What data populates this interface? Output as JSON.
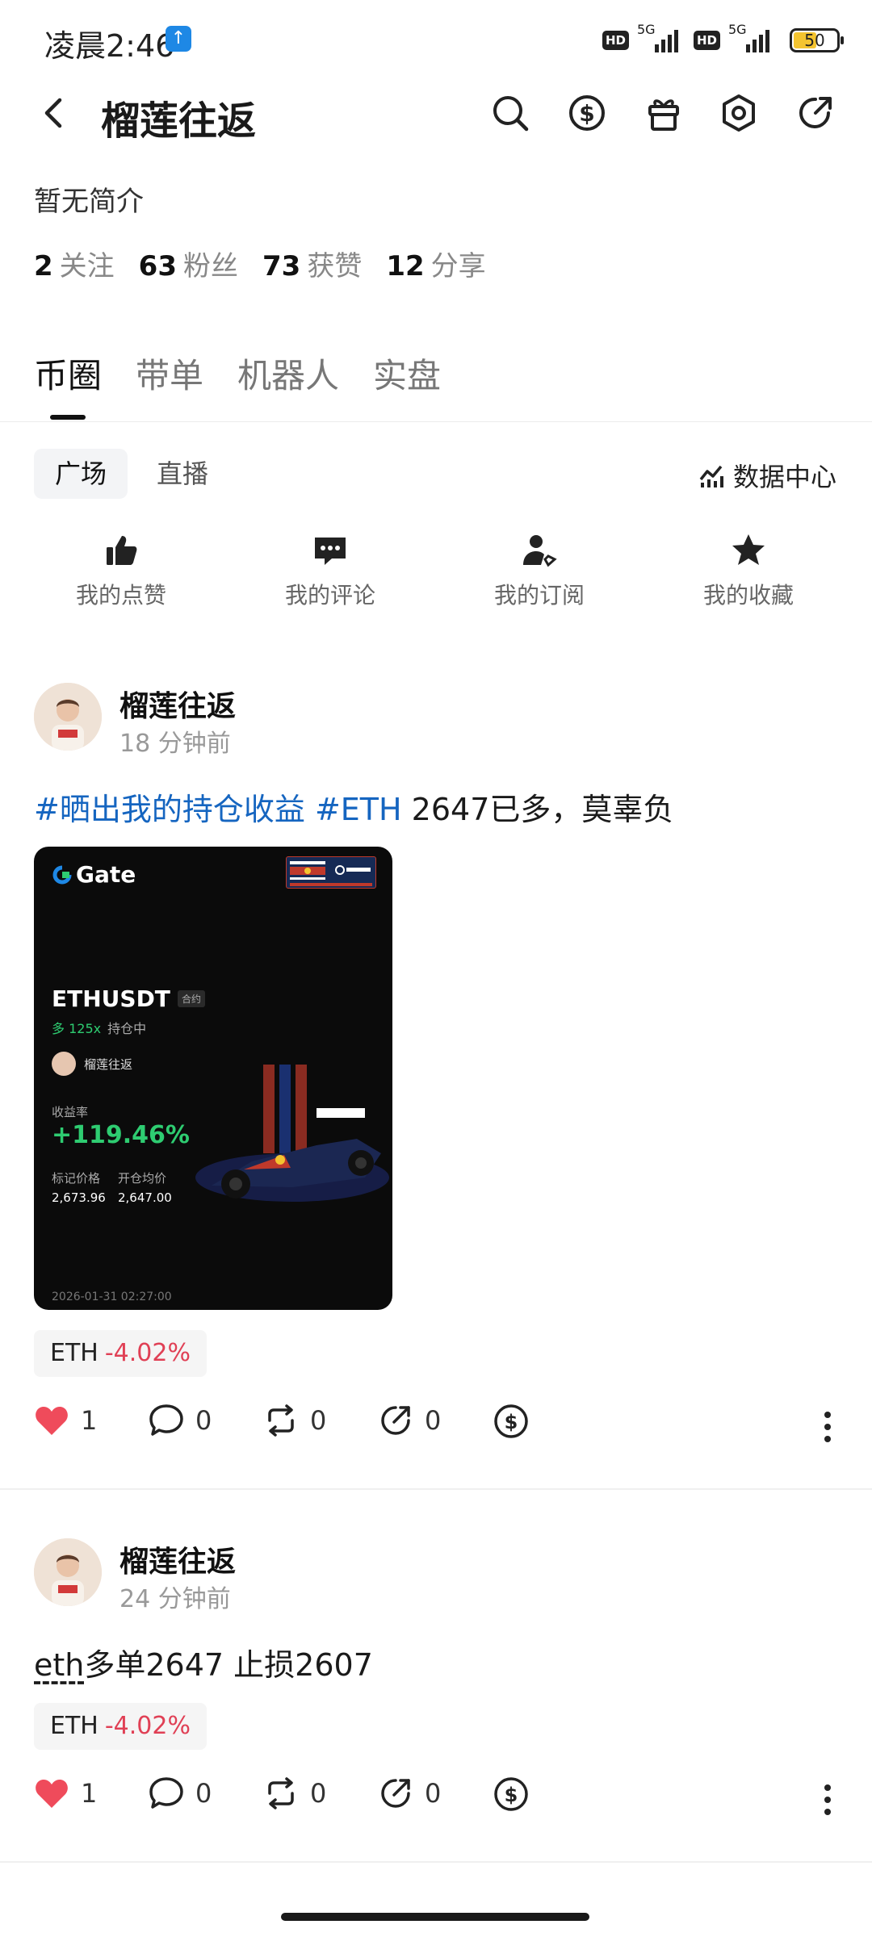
{
  "status": {
    "time": "凌晨2:46",
    "net1": "5G",
    "net2": "5G",
    "hd": "HD",
    "battery": "50"
  },
  "header": {
    "title": "榴莲往返"
  },
  "profile": {
    "bio": "暂无简介",
    "stats": [
      {
        "value": "2",
        "label": "关注"
      },
      {
        "value": "63",
        "label": "粉丝"
      },
      {
        "value": "73",
        "label": "获赞"
      },
      {
        "value": "12",
        "label": "分享"
      }
    ]
  },
  "tabs": [
    "币圈",
    "带单",
    "机器人",
    "实盘"
  ],
  "subtabs": [
    "广场",
    "直播"
  ],
  "data_center": "数据中心",
  "quick_actions": [
    "我的点赞",
    "我的评论",
    "我的订阅",
    "我的收藏"
  ],
  "posts": [
    {
      "author": "榴莲往返",
      "time": "18 分钟前",
      "tag1": "#晒出我的持仓收益",
      "tag2": "#ETH",
      "text": " 2647已多，莫辜负",
      "card": {
        "brand": "Gate",
        "pair": "ETHUSDT",
        "contract": "合约",
        "direction": "多 125x",
        "holding": "持仓中",
        "user": "榴莲往返",
        "return_label": "收益率",
        "return": "+119.46%",
        "mark_label": "标记价格",
        "mark": "2,673.96",
        "entry_label": "开仓均价",
        "entry": "2,647.00",
        "timestamp": "2026-01-31 02:27:00"
      },
      "chip_symbol": "ETH",
      "chip_change": "-4.02%",
      "likes": "1",
      "comments": "0",
      "reposts": "0",
      "shares": "0"
    },
    {
      "author": "榴莲往返",
      "time": "24 分钟前",
      "text_link": "eth",
      "text": "多单2647 止损2607",
      "chip_symbol": "ETH",
      "chip_change": "-4.02%",
      "likes": "1",
      "comments": "0",
      "reposts": "0",
      "shares": "0"
    }
  ],
  "colors": {
    "link": "#1565c0",
    "negative": "#e04055",
    "positive": "#2ecc71",
    "like": "#ef4b5b"
  }
}
